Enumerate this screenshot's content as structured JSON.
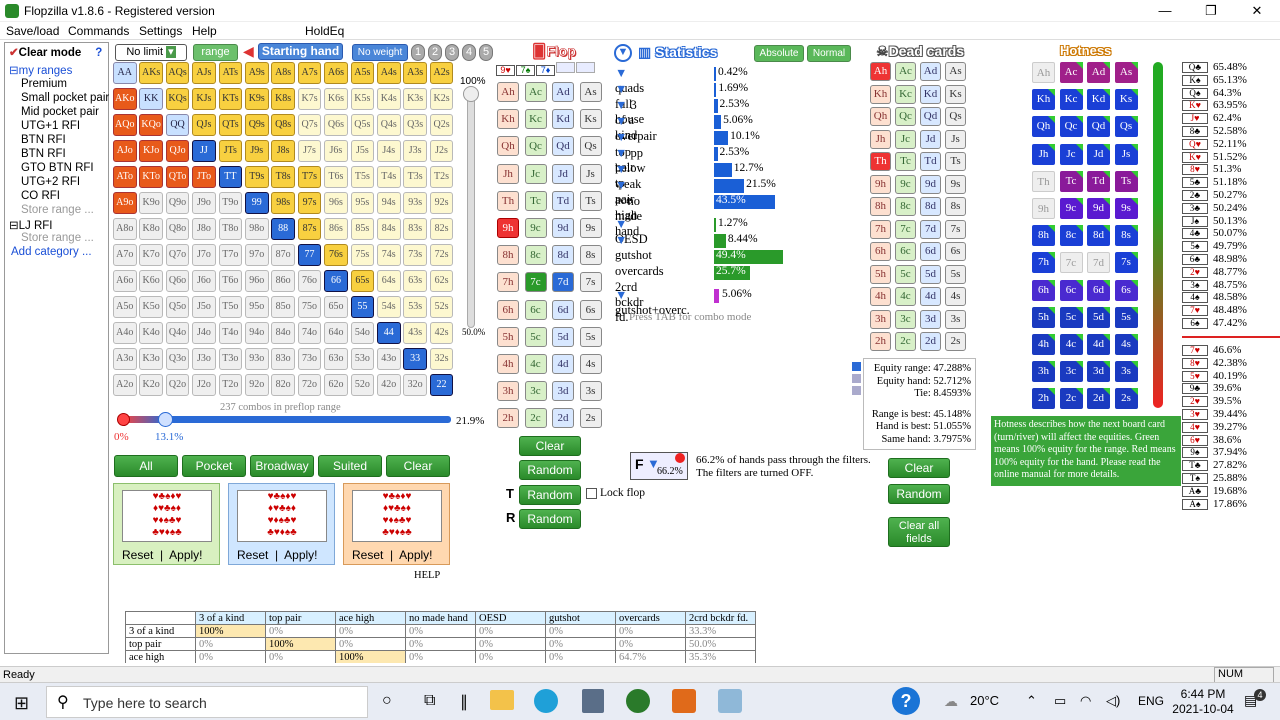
{
  "title": "Flopzilla v1.8.6 - Registered version",
  "menu": [
    "Save/load",
    "Commands",
    "Settings",
    "Help",
    "HoldEq"
  ],
  "sidebar": {
    "clear_mode": "Clear mode",
    "help": "?",
    "items": [
      "my ranges",
      "Premium",
      "Small pocket pair",
      "Mid pocket pair",
      "UTG+1 RFI",
      "BTN RFI",
      "BTN RFI",
      "GTO BTN RFI",
      "UTG+2 RFI",
      "CO RFI",
      "Store range ...",
      "LJ RFI",
      "Store range ...",
      "Add category ..."
    ]
  },
  "range": {
    "limit": "No limit",
    "range_btn": "range",
    "starting_hand": "Starting hand",
    "no_weight": "No weight",
    "weights": [
      "1",
      "2",
      "3",
      "4",
      "5"
    ],
    "slider_top": "100%",
    "slider_mid": "50.0%",
    "combos": "237 combos in preflop range",
    "pct_right": "21.9%",
    "pct_zero": "0%",
    "pct_low": "13.1%"
  },
  "hands": [
    [
      "AA",
      "AKs",
      "AQs",
      "AJs",
      "ATs",
      "A9s",
      "A8s",
      "A7s",
      "A6s",
      "A5s",
      "A4s",
      "A3s",
      "A2s"
    ],
    [
      "AKo",
      "KK",
      "KQs",
      "KJs",
      "KTs",
      "K9s",
      "K8s",
      "K7s",
      "K6s",
      "K5s",
      "K4s",
      "K3s",
      "K2s"
    ],
    [
      "AQo",
      "KQo",
      "QQ",
      "QJs",
      "QTs",
      "Q9s",
      "Q8s",
      "Q7s",
      "Q6s",
      "Q5s",
      "Q4s",
      "Q3s",
      "Q2s"
    ],
    [
      "AJo",
      "KJo",
      "QJo",
      "JJ",
      "JTs",
      "J9s",
      "J8s",
      "J7s",
      "J6s",
      "J5s",
      "J4s",
      "J3s",
      "J2s"
    ],
    [
      "ATo",
      "KTo",
      "QTo",
      "JTo",
      "TT",
      "T9s",
      "T8s",
      "T7s",
      "T6s",
      "T5s",
      "T4s",
      "T3s",
      "T2s"
    ],
    [
      "A9o",
      "K9o",
      "Q9o",
      "J9o",
      "T9o",
      "99",
      "98s",
      "97s",
      "96s",
      "95s",
      "94s",
      "93s",
      "92s"
    ],
    [
      "A8o",
      "K8o",
      "Q8o",
      "J8o",
      "T8o",
      "98o",
      "88",
      "87s",
      "86s",
      "85s",
      "84s",
      "83s",
      "82s"
    ],
    [
      "A7o",
      "K7o",
      "Q7o",
      "J7o",
      "T7o",
      "97o",
      "87o",
      "77",
      "76s",
      "75s",
      "74s",
      "73s",
      "72s"
    ],
    [
      "A6o",
      "K6o",
      "Q6o",
      "J6o",
      "T6o",
      "96o",
      "86o",
      "76o",
      "66",
      "65s",
      "64s",
      "63s",
      "62s"
    ],
    [
      "A5o",
      "K5o",
      "Q5o",
      "J5o",
      "T5o",
      "95o",
      "85o",
      "75o",
      "65o",
      "55",
      "54s",
      "53s",
      "52s"
    ],
    [
      "A4o",
      "K4o",
      "Q4o",
      "J4o",
      "T4o",
      "94o",
      "84o",
      "74o",
      "64o",
      "54o",
      "44",
      "43s",
      "42s"
    ],
    [
      "A3o",
      "K3o",
      "Q3o",
      "J3o",
      "T3o",
      "93o",
      "83o",
      "73o",
      "63o",
      "53o",
      "43o",
      "33",
      "32s"
    ],
    [
      "A2o",
      "K2o",
      "Q2o",
      "J2o",
      "T2o",
      "92o",
      "82o",
      "72o",
      "62o",
      "52o",
      "42o",
      "32o",
      "22"
    ]
  ],
  "hand_buttons": [
    "All",
    "Pocket",
    "Broadway",
    "Suited",
    "Clear"
  ],
  "preset": {
    "reset": "Reset",
    "apply": "Apply!",
    "help": "HELP"
  },
  "flop": {
    "title": "Flop",
    "cards": [
      "9♥",
      "7♠",
      "7♦"
    ],
    "ranks": [
      "A",
      "K",
      "Q",
      "J",
      "T",
      "9",
      "8",
      "7",
      "6",
      "5",
      "4",
      "3",
      "2"
    ],
    "suits": [
      "h",
      "c",
      "d",
      "s"
    ],
    "clear": "Clear",
    "random": "Random",
    "lock": "Lock flop"
  },
  "stats": {
    "title": "Statistics",
    "absolute": "Absolute",
    "normal": "Normal",
    "rows": [
      {
        "label": "quads",
        "pct": "0.42%",
        "v": 0.42
      },
      {
        "label": "full house",
        "pct": "1.69%",
        "v": 1.69
      },
      {
        "label": "3 of a kind",
        "pct": "2.53%",
        "v": 2.53
      },
      {
        "label": "overpair",
        "pct": "5.06%",
        "v": 5.06
      },
      {
        "label": "top pair",
        "pct": "10.1%",
        "v": 10.1
      },
      {
        "label": "pp below tp",
        "pct": "2.53%",
        "v": 2.53
      },
      {
        "label": "weak pair",
        "pct": "12.7%",
        "v": 12.7
      },
      {
        "label": "ace high",
        "pct": "21.5%",
        "v": 21.5
      },
      {
        "label": "no made hand",
        "pct": "43.5%",
        "v": 43.5
      }
    ],
    "rows2": [
      {
        "label": "OESD",
        "pct": "1.27%",
        "v": 1.27
      },
      {
        "label": "gutshot",
        "pct": "8.44%",
        "v": 8.44
      },
      {
        "label": "overcards",
        "pct": "49.4%",
        "v": 49.4
      },
      {
        "label": "2crd bckdr fd.",
        "pct": "25.7%",
        "v": 25.7
      }
    ],
    "combo": {
      "label": "gutshot+overc.",
      "pct": "5.06%",
      "v": 5.06
    },
    "tab_hint": "Press TAB for combo mode",
    "filter_pct": "66.2%",
    "filter_text": "66.2% of hands pass through the filters. The filters are turned OFF."
  },
  "dead": {
    "title": "Dead cards",
    "clear": "Clear",
    "random": "Random",
    "clear_all": "Clear all fields"
  },
  "equity": {
    "l1": "Equity range: 47.288%",
    "l2": "Equity hand: 52.712%",
    "l3": "Tie: 8.4593%",
    "l4": "Range is best: 45.148%",
    "l5": "Hand is best: 51.055%",
    "l6": "Same hand: 3.7975%"
  },
  "hotness": {
    "title": "Hotness",
    "desc": "Hotness describes how the next board card (turn/river) will affect the equities. Green means 100% equity for the range. Red means 100% equity for the hand. Please read the online manual for more details.",
    "list": [
      [
        "Q♣",
        "65.48%"
      ],
      [
        "K♠",
        "65.13%"
      ],
      [
        "Q♠",
        "64.3%"
      ],
      [
        "K♥",
        "63.95%"
      ],
      [
        "J♥",
        "62.4%"
      ],
      [
        "8♣",
        "52.58%"
      ],
      [
        "Q♥",
        "52.11%"
      ],
      [
        "K♥",
        "51.52%"
      ],
      [
        "8♥",
        "51.3%"
      ],
      [
        "5♣",
        "51.18%"
      ],
      [
        "2♣",
        "50.27%"
      ],
      [
        "3♣",
        "50.24%"
      ],
      [
        "J♠",
        "50.13%"
      ],
      [
        "4♣",
        "50.07%"
      ],
      [
        "5♠",
        "49.79%"
      ],
      [
        "6♣",
        "48.98%"
      ],
      [
        "2♥",
        "48.77%"
      ],
      [
        "3♠",
        "48.75%"
      ],
      [
        "4♠",
        "48.58%"
      ],
      [
        "7♥",
        "48.48%"
      ],
      [
        "6♠",
        "47.42%"
      ],
      [
        "7♥",
        "46.6%"
      ],
      [
        "8♥",
        "42.38%"
      ],
      [
        "5♥",
        "40.19%"
      ],
      [
        "9♣",
        "39.6%"
      ],
      [
        "2♥",
        "39.5%"
      ],
      [
        "3♥",
        "39.44%"
      ],
      [
        "4♥",
        "39.27%"
      ],
      [
        "6♥",
        "38.6%"
      ],
      [
        "9♠",
        "37.94%"
      ],
      [
        "T♣",
        "27.82%"
      ],
      [
        "T♠",
        "25.88%"
      ],
      [
        "A♣",
        "19.68%"
      ],
      [
        "A♠",
        "17.86%"
      ]
    ]
  },
  "table": {
    "headers": [
      "",
      "3 of a kind",
      "top pair",
      "ace high",
      "no made hand",
      "OESD",
      "gutshot",
      "overcards",
      "2crd bckdr fd."
    ],
    "rows": [
      [
        "3 of a kind",
        "100%",
        "0%",
        "0%",
        "0%",
        "0%",
        "0%",
        "0%",
        "33.3%"
      ],
      [
        "top pair",
        "0%",
        "100%",
        "0%",
        "0%",
        "0%",
        "0%",
        "0%",
        "50.0%"
      ],
      [
        "ace high",
        "0%",
        "0%",
        "100%",
        "0%",
        "0%",
        "0%",
        "64.7%",
        "35.3%"
      ]
    ]
  },
  "status": {
    "ready": "Ready",
    "num": "NUM"
  },
  "taskbar": {
    "search": "Type here to search",
    "temp": "20°C",
    "lang": "ENG",
    "time": "6:44 PM",
    "date": "2021-10-04",
    "notif": "4"
  }
}
